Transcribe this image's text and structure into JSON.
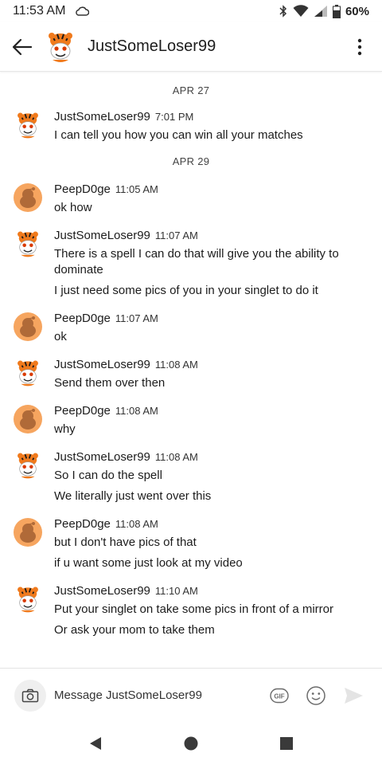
{
  "status": {
    "time": "11:53 AM",
    "battery": "60%"
  },
  "header": {
    "title": "JustSomeLoser99"
  },
  "thread": {
    "date_1": "APR 27",
    "date_2": "APR 29",
    "messages": [
      {
        "user": "JustSomeLoser99",
        "time": "7:01 PM",
        "lines": [
          "I can tell you how you can win all your matches"
        ]
      },
      {
        "user": "PeepD0ge",
        "time": "11:05 AM",
        "lines": [
          "ok how"
        ]
      },
      {
        "user": "JustSomeLoser99",
        "time": "11:07 AM",
        "lines": [
          "There is a spell I can do that will give you the ability to dominate",
          "I just need some pics of you in your singlet to do it"
        ]
      },
      {
        "user": "PeepD0ge",
        "time": "11:07 AM",
        "lines": [
          "ok"
        ]
      },
      {
        "user": "JustSomeLoser99",
        "time": "11:08 AM",
        "lines": [
          "Send them over then"
        ]
      },
      {
        "user": "PeepD0ge",
        "time": "11:08 AM",
        "lines": [
          "why"
        ]
      },
      {
        "user": "JustSomeLoser99",
        "time": "11:08 AM",
        "lines": [
          "So I can do the spell",
          "We literally just went over this"
        ]
      },
      {
        "user": "PeepD0ge",
        "time": "11:08 AM",
        "lines": [
          "but I don't have pics of that",
          "if u want some just look at my video"
        ]
      },
      {
        "user": "JustSomeLoser99",
        "time": "11:10 AM",
        "lines": [
          "Put your singlet on take some pics in front of a mirror",
          "Or ask your mom to take them"
        ]
      }
    ]
  },
  "composer": {
    "placeholder": "Message JustSomeLoser99",
    "gif_label": "GIF"
  },
  "colors": {
    "snoo_orange": "#f6a55f",
    "tiger_orange": "#f07a1c",
    "icon_gray": "#6b6b6b"
  }
}
